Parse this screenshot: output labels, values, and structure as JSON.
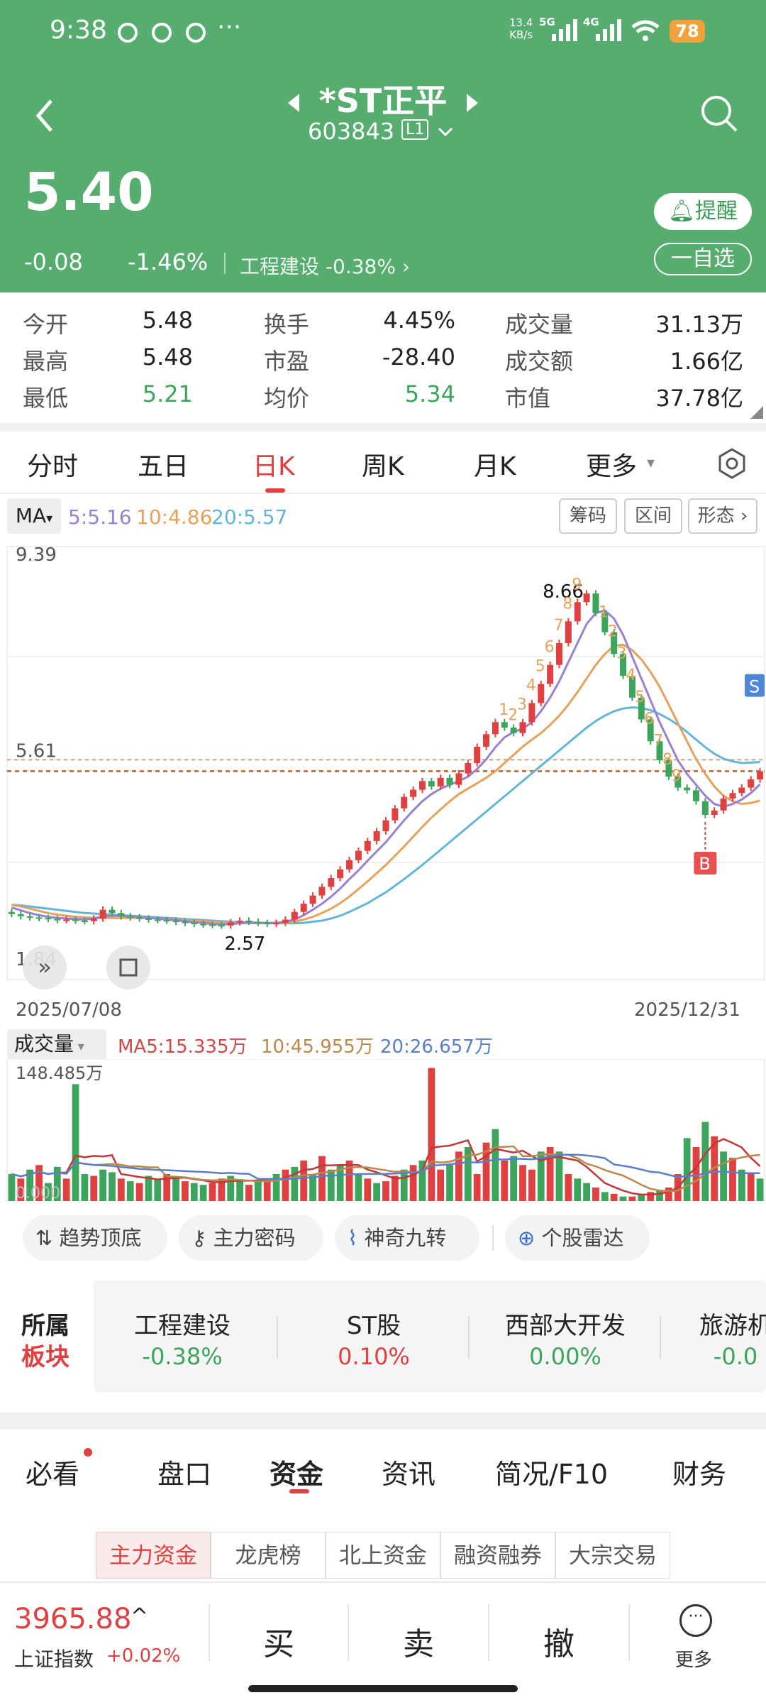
{
  "status_bar": {
    "time": "9:38",
    "dots": "···",
    "net_speed_top": "13.4",
    "net_speed_bottom": "KB/s",
    "net1": "5G",
    "net2": "4G",
    "battery": "78"
  },
  "header": {
    "title": "*ST正平",
    "code": "603843",
    "level": "L1",
    "price": "5.40",
    "change": "-0.08",
    "change_pct": "-1.46%",
    "industry": "工程建设",
    "industry_pct": "-0.38%",
    "remind_label": "提醒",
    "watch_label": "一自选"
  },
  "quote": [
    [
      {
        "label": "今开",
        "value": "5.48"
      },
      {
        "label": "换手",
        "value": "4.45%"
      },
      {
        "label": "成交量",
        "value": "31.13万"
      }
    ],
    [
      {
        "label": "最高",
        "value": "5.48"
      },
      {
        "label": "市盈",
        "value": "-28.40"
      },
      {
        "label": "成交额",
        "value": "1.66亿"
      }
    ],
    [
      {
        "label": "最低",
        "value": "5.21"
      },
      {
        "label": "均价",
        "value": "5.34"
      },
      {
        "label": "市值",
        "value": "37.78亿"
      }
    ]
  ],
  "chart_tabs": [
    "分时",
    "五日",
    "日K",
    "周K",
    "月K",
    "更多"
  ],
  "active_tab": "日K",
  "ma_bar": {
    "label": "MA",
    "ma5": "5:5.16",
    "ma10": "10:4.86",
    "ma20": "20:5.57",
    "btn1": "筹码",
    "btn2": "区间",
    "btn3": "形态"
  },
  "colors": {
    "header_green": "#57ad70",
    "up_red": "#e04040",
    "down_green": "#3ca55c",
    "ma5": "#9a7fd6",
    "ma10": "#e6a15a",
    "ma20": "#62b5d9"
  },
  "chart_data": {
    "type": "candlestick",
    "title": "",
    "x_start": "2025/07/08",
    "x_end": "2025/12/31",
    "ylim": [
      1.84,
      9.39
    ],
    "y_labels": [
      "9.39",
      "5.61",
      "1.84"
    ],
    "high_label": "8.66",
    "low_label": "2.57",
    "ref_line": 5.61,
    "price_line": 5.4,
    "buy_marker": "B",
    "sell_marker": "S",
    "close_series": [
      2.78,
      2.74,
      2.72,
      2.71,
      2.69,
      2.67,
      2.68,
      2.66,
      2.65,
      2.7,
      2.86,
      2.8,
      2.74,
      2.72,
      2.7,
      2.68,
      2.67,
      2.66,
      2.64,
      2.62,
      2.6,
      2.59,
      2.58,
      2.57,
      2.63,
      2.66,
      2.64,
      2.62,
      2.6,
      2.62,
      2.68,
      2.82,
      2.97,
      3.12,
      3.28,
      3.44,
      3.6,
      3.77,
      3.94,
      4.12,
      4.3,
      4.5,
      4.72,
      4.93,
      5.06,
      5.22,
      5.12,
      5.28,
      5.15,
      5.36,
      5.55,
      5.85,
      6.08,
      6.3,
      6.2,
      6.1,
      6.3,
      6.65,
      7.0,
      7.35,
      7.75,
      8.15,
      8.5,
      8.66,
      8.3,
      7.95,
      7.55,
      7.15,
      6.75,
      6.35,
      5.95,
      5.6,
      5.3,
      5.1,
      5.05,
      4.85,
      4.6,
      4.68,
      4.9,
      5.0,
      5.1,
      5.25,
      5.4
    ],
    "ma5": [
      2.9,
      2.85,
      2.8,
      2.76,
      2.73,
      2.71,
      2.7,
      2.69,
      2.68,
      2.7,
      2.74,
      2.75,
      2.75,
      2.74,
      2.73,
      2.71,
      2.7,
      2.68,
      2.67,
      2.65,
      2.63,
      2.62,
      2.6,
      2.59,
      2.6,
      2.61,
      2.62,
      2.62,
      2.62,
      2.62,
      2.64,
      2.68,
      2.76,
      2.86,
      2.97,
      3.1,
      3.25,
      3.42,
      3.58,
      3.76,
      3.93,
      4.1,
      4.3,
      4.5,
      4.68,
      4.85,
      4.98,
      5.08,
      5.15,
      5.22,
      5.3,
      5.44,
      5.62,
      5.84,
      6.02,
      6.12,
      6.18,
      6.3,
      6.5,
      6.75,
      7.05,
      7.4,
      7.75,
      8.1,
      8.3,
      8.35,
      8.2,
      7.9,
      7.5,
      7.1,
      6.7,
      6.3,
      5.95,
      5.6,
      5.35,
      5.15,
      4.95,
      4.8,
      4.75,
      4.8,
      4.88,
      5.0,
      5.16
    ],
    "ma10": [
      2.95,
      2.92,
      2.88,
      2.84,
      2.8,
      2.77,
      2.75,
      2.73,
      2.72,
      2.71,
      2.71,
      2.71,
      2.71,
      2.71,
      2.71,
      2.71,
      2.7,
      2.69,
      2.68,
      2.67,
      2.66,
      2.65,
      2.64,
      2.63,
      2.62,
      2.62,
      2.62,
      2.61,
      2.61,
      2.61,
      2.62,
      2.64,
      2.68,
      2.73,
      2.8,
      2.88,
      2.98,
      3.1,
      3.24,
      3.38,
      3.53,
      3.68,
      3.85,
      4.02,
      4.2,
      4.38,
      4.55,
      4.7,
      4.85,
      4.98,
      5.08,
      5.18,
      5.28,
      5.4,
      5.55,
      5.7,
      5.85,
      5.98,
      6.1,
      6.25,
      6.42,
      6.62,
      6.85,
      7.1,
      7.35,
      7.55,
      7.7,
      7.72,
      7.62,
      7.45,
      7.22,
      6.95,
      6.62,
      6.28,
      5.95,
      5.62,
      5.35,
      5.12,
      4.95,
      4.85,
      4.8,
      4.82,
      4.86
    ],
    "ma20": [
      2.95,
      2.94,
      2.92,
      2.9,
      2.88,
      2.86,
      2.84,
      2.82,
      2.8,
      2.79,
      2.78,
      2.77,
      2.76,
      2.75,
      2.74,
      2.73,
      2.72,
      2.71,
      2.7,
      2.69,
      2.68,
      2.67,
      2.66,
      2.65,
      2.64,
      2.63,
      2.63,
      2.62,
      2.62,
      2.61,
      2.61,
      2.61,
      2.62,
      2.64,
      2.66,
      2.7,
      2.75,
      2.82,
      2.9,
      2.98,
      3.08,
      3.18,
      3.3,
      3.42,
      3.55,
      3.68,
      3.82,
      3.96,
      4.1,
      4.24,
      4.38,
      4.52,
      4.66,
      4.8,
      4.94,
      5.08,
      5.22,
      5.36,
      5.5,
      5.64,
      5.78,
      5.92,
      6.06,
      6.2,
      6.32,
      6.42,
      6.5,
      6.55,
      6.57,
      6.56,
      6.52,
      6.45,
      6.36,
      6.25,
      6.12,
      5.98,
      5.84,
      5.72,
      5.63,
      5.58,
      5.55,
      5.56,
      5.57
    ],
    "seq_down": [
      "9",
      "8",
      "7",
      "6",
      "5",
      "4",
      "3",
      "2",
      "1"
    ],
    "seq_up_labels": [
      "1",
      "2",
      "3",
      "4",
      "5",
      "6",
      "7",
      "8",
      "9"
    ]
  },
  "volume": {
    "label": "成交量",
    "ma5": "MA5:15.335万",
    "ma10": "10:45.955万",
    "ma20": "20:26.657万",
    "max_label": "148.485万",
    "min_label": "0.000",
    "bars": [
      30,
      25,
      35,
      40,
      20,
      38,
      25,
      130,
      30,
      28,
      35,
      32,
      25,
      22,
      20,
      28,
      25,
      30,
      25,
      22,
      20,
      18,
      20,
      25,
      28,
      22,
      18,
      22,
      25,
      30,
      35,
      38,
      45,
      30,
      50,
      35,
      40,
      45,
      30,
      25,
      20,
      22,
      28,
      35,
      40,
      45,
      148,
      35,
      40,
      55,
      60,
      30,
      65,
      80,
      45,
      50,
      40,
      35,
      55,
      60,
      55,
      30,
      25,
      20,
      15,
      10,
      8,
      5,
      5,
      8,
      10,
      12,
      15,
      30,
      70,
      60,
      88,
      72,
      55,
      48,
      35,
      30,
      25
    ],
    "colors": [
      "g",
      "r",
      "g",
      "r",
      "g",
      "g",
      "r",
      "g",
      "g",
      "r",
      "g",
      "g",
      "r",
      "g",
      "r",
      "g",
      "g",
      "r",
      "g",
      "r",
      "g",
      "g",
      "r",
      "r",
      "g",
      "g",
      "r",
      "g",
      "r",
      "g",
      "r",
      "g",
      "r",
      "g",
      "r",
      "g",
      "g",
      "r",
      "g",
      "r",
      "g",
      "r",
      "r",
      "g",
      "r",
      "g",
      "r",
      "r",
      "g",
      "r",
      "g",
      "r",
      "r",
      "g",
      "r",
      "g",
      "r",
      "r",
      "g",
      "r",
      "g",
      "r",
      "g",
      "g",
      "r",
      "g",
      "r",
      "g",
      "r",
      "g",
      "r",
      "g",
      "r",
      "r",
      "g",
      "r",
      "g",
      "r",
      "g",
      "r",
      "g",
      "r",
      "g"
    ]
  },
  "indicators": [
    "趋势顶底",
    "主力密码",
    "神奇九转",
    "个股雷达"
  ],
  "sector": {
    "label_top": "所属",
    "label_bottom": "板块",
    "items": [
      {
        "name": "工程建设",
        "pct": "-0.38%",
        "dir": "down"
      },
      {
        "name": "ST股",
        "pct": "0.10%",
        "dir": "up"
      },
      {
        "name": "西部大开发",
        "pct": "0.00%",
        "dir": "flat"
      },
      {
        "name": "旅游机",
        "pct": "-0.0",
        "dir": "down"
      }
    ]
  },
  "bottom_tabs": [
    "必看",
    "盘口",
    "资金",
    "资讯",
    "简况/F10",
    "财务"
  ],
  "active_bottom_tab": "资金",
  "sub_tabs": [
    "主力资金",
    "龙虎榜",
    "北上资金",
    "融资融券",
    "大宗交易"
  ],
  "bottom_bar": {
    "index_value": "3965.88",
    "index_name": "上证指数",
    "index_pct": "+0.02%",
    "buy": "买",
    "sell": "卖",
    "cancel": "撤",
    "more": "更多"
  }
}
